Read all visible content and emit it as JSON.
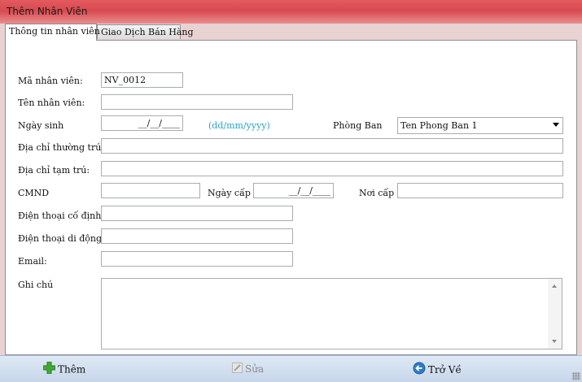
{
  "window": {
    "title": "Thêm Nhân Viên"
  },
  "tabs": [
    {
      "label": "Thông tin nhân viên",
      "active": true
    },
    {
      "label": "Giao Dịch Bán Hàng",
      "active": false
    }
  ],
  "form": {
    "ma_nv": {
      "label": "Mã nhân viên:",
      "value": "NV_0012"
    },
    "ten_nv": {
      "label": "Tên nhân viên:",
      "value": ""
    },
    "ngay_sinh": {
      "label": "Ngày sinh",
      "value": "__/__/____",
      "hint": "(dd/mm/yyyy)"
    },
    "phong_ban": {
      "label": "Phòng Ban",
      "value": "Ten Phong Ban 1"
    },
    "dc_thuong_tru": {
      "label": "Địa chỉ thường trú:",
      "value": ""
    },
    "dc_tam_tru": {
      "label": "Địa chỉ tạm trú:",
      "value": ""
    },
    "cmnd": {
      "label": "CMND",
      "value": ""
    },
    "ngay_cap": {
      "label": "Ngày cấp",
      "value": "__/__/____"
    },
    "noi_cap": {
      "label": "Nơi cấp",
      "value": ""
    },
    "dt_co_dinh": {
      "label": "Điện thoại cố định",
      "value": ""
    },
    "dt_di_dong": {
      "label": "Điện thoại di động",
      "value": ""
    },
    "email": {
      "label": "Email:",
      "value": ""
    },
    "ghi_chu": {
      "label": "Ghi chú",
      "value": ""
    }
  },
  "toolbar": {
    "add_label": "Thêm",
    "edit_label": "Sửa",
    "back_label": "Trở Về"
  },
  "colors": {
    "title_bar": "#d74a50",
    "hint": "#2aa3c9",
    "toolbar": "#c7d6ea"
  }
}
